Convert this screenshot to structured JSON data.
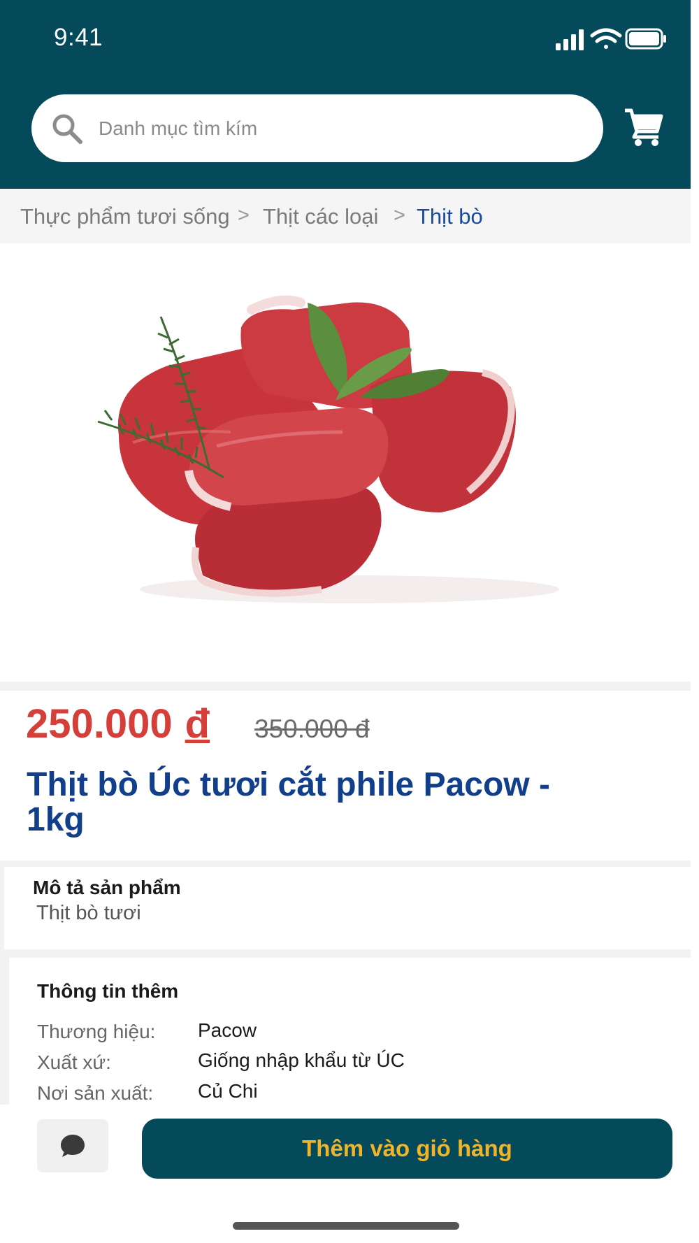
{
  "status_bar": {
    "time": "9:41"
  },
  "search": {
    "placeholder": "Danh mục tìm kím"
  },
  "breadcrumb": {
    "items": [
      "Thực phẩm tươi sống",
      "Thịt các loại",
      "Thịt bò"
    ],
    "separator": ">"
  },
  "product": {
    "price": "250.000",
    "currency": "đ",
    "old_price": "350.000 đ",
    "title": "Thịt bò Úc tươi cắt phile Pacow - 1kg"
  },
  "description": {
    "label": "Mô tả sản phẩm",
    "text": "Thịt bò tươi"
  },
  "extra_info": {
    "title": "Thông tin thêm",
    "rows": [
      {
        "label": "Thương hiệu:",
        "value": "Pacow"
      },
      {
        "label": "Xuất xứ:",
        "value": "Giống nhập khẩu từ ÚC"
      },
      {
        "label": "Nơi sản xuất:",
        "value": "Củ Chi"
      }
    ]
  },
  "actions": {
    "add_to_cart": "Thêm vào giỏ hàng"
  },
  "colors": {
    "header": "#044a5b",
    "price": "#d53f3a",
    "title": "#123f8c",
    "button_text": "#f0b429"
  }
}
